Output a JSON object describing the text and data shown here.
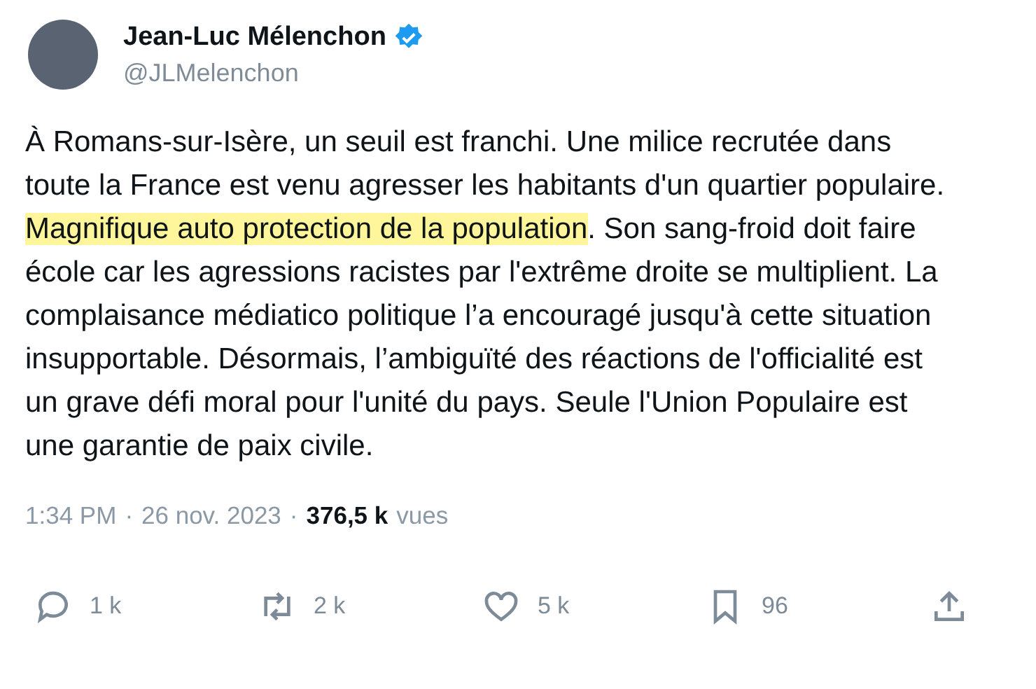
{
  "author": {
    "name": "Jean-Luc Mélenchon",
    "verified": true,
    "handle": "@JLMelenchon"
  },
  "body": [
    {
      "text": "À Romans-sur-Isère, un seuil est franchi. Une milice recrutée dans toute la France est venu agresser les habitants d'un quartier populaire. ",
      "highlighted": false
    },
    {
      "text": "Magnifique auto protection de la population",
      "highlighted": true
    },
    {
      "text": ". Son sang-froid doit faire école car les agressions racistes par l'extrême droite se multiplient. La complaisance médiatico politique l’a encouragé jusqu'à cette situation insupportable. Désormais, l’ambiguïté des réactions de l'officialité est un grave défi moral pour l'unité du pays. Seule l'Union Populaire est une garantie de paix civile.",
      "highlighted": false
    }
  ],
  "meta": {
    "separators": [
      "·",
      "·"
    ],
    "time": "1:34 PM",
    "date": "26 nov. 2023",
    "views_count": "376,5 k",
    "views_label": "vues"
  },
  "actions": [
    {
      "kind": "reply",
      "count": "1 k"
    },
    {
      "kind": "repost",
      "count": "2 k"
    },
    {
      "kind": "like",
      "count": "5 k"
    },
    {
      "kind": "bookmark",
      "count": "96"
    },
    {
      "kind": "share"
    }
  ]
}
